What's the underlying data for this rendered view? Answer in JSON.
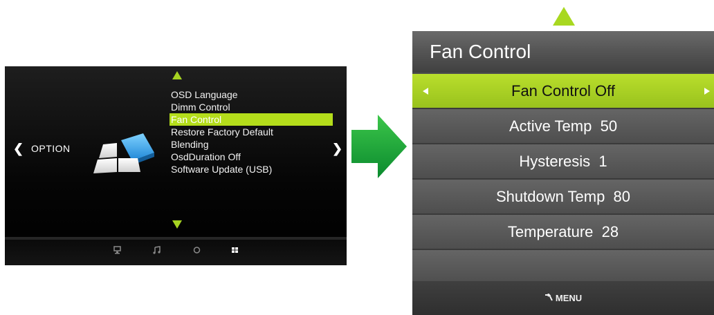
{
  "left_osd": {
    "section_label": "OPTION",
    "nav_left": "❮",
    "nav_right": "❯",
    "menu_items": [
      {
        "label": "OSD Language"
      },
      {
        "label": "Dimm Control"
      },
      {
        "label": "Fan Control",
        "selected": true
      },
      {
        "label": "Restore Factory Default"
      },
      {
        "label": "Blending"
      },
      {
        "label": "OsdDuration Off"
      },
      {
        "label": "Software Update (USB)"
      }
    ],
    "bottom_icons": [
      "monitor-icon",
      "music-icon",
      "clock-icon",
      "option-grid-icon"
    ]
  },
  "fan_control_panel": {
    "title": "Fan Control",
    "rows": [
      {
        "label": "Fan Control Off",
        "selected": true
      },
      {
        "label": "Active Temp  50"
      },
      {
        "label": "Hysteresis  1"
      },
      {
        "label": "Shutdown Temp  80"
      },
      {
        "label": "Temperature  28"
      },
      {
        "label": ""
      }
    ],
    "footer_label": "MENU"
  },
  "colors": {
    "accent_green": "#b4dd1b",
    "arrow_green": "#1faa3a",
    "panel_gray": "#5a5a5a"
  }
}
